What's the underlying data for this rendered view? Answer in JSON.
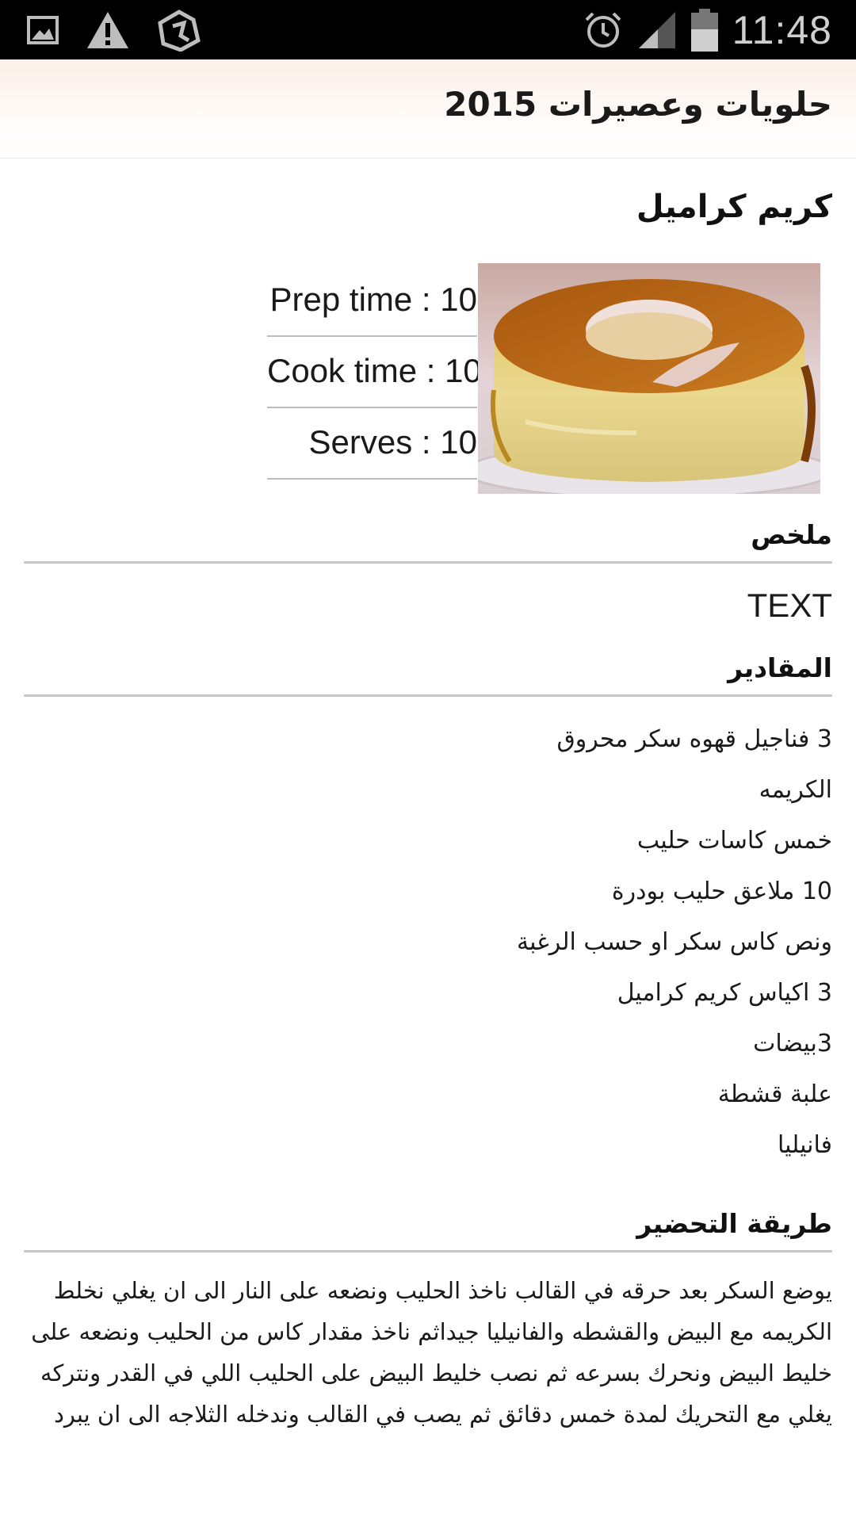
{
  "status_bar": {
    "time": "11:48",
    "left_icons": [
      "image-icon",
      "warning-icon",
      "bug-icon"
    ],
    "right_icons": [
      "alarm-icon",
      "signal-icon",
      "battery-icon"
    ]
  },
  "header": {
    "title": "حلويات وعصيرات 2015"
  },
  "recipe": {
    "title": "كريم كراميل",
    "image_label": "crème caramel photo",
    "prep_time": "Prep time : 10",
    "cook_time": "Cook time : 10",
    "serves": "Serves : 10"
  },
  "summary": {
    "heading": "ملخص",
    "text": "TEXT"
  },
  "ingredients": {
    "heading": "المقادير",
    "items": [
      "3 فناجيل قهوه سكر محروق",
      "الكريمه",
      "خمس كاسات حليب",
      "10 ملاعق حليب بودرة",
      "ونص كاس سكر او حسب الرغبة",
      "3 اكياس كريم كراميل",
      "3بيضات",
      "علبة قشطة",
      "فانيليا"
    ]
  },
  "method": {
    "heading": "طريقة التحضير",
    "text": "يوضع السكر بعد حرقه في القالب ناخذ الحليب ونضعه على النار الى ان يغلي نخلط الكريمه مع البيض والقشطه والفانيليا جيداثم ناخذ مقدار كاس من الحليب ونضعه على خليط البيض ونحرك بسرعه ثم نصب خليط البيض على الحليب اللي في القدر ونتركه يغلي مع التحريك لمدة خمس دقائق ثم يصب في القالب وندخله الثلاجه الى ان يبرد"
  },
  "colors": {
    "status_bar": "#000000",
    "header_tint": "#fcefe8",
    "divider": "#c7c7c7"
  }
}
